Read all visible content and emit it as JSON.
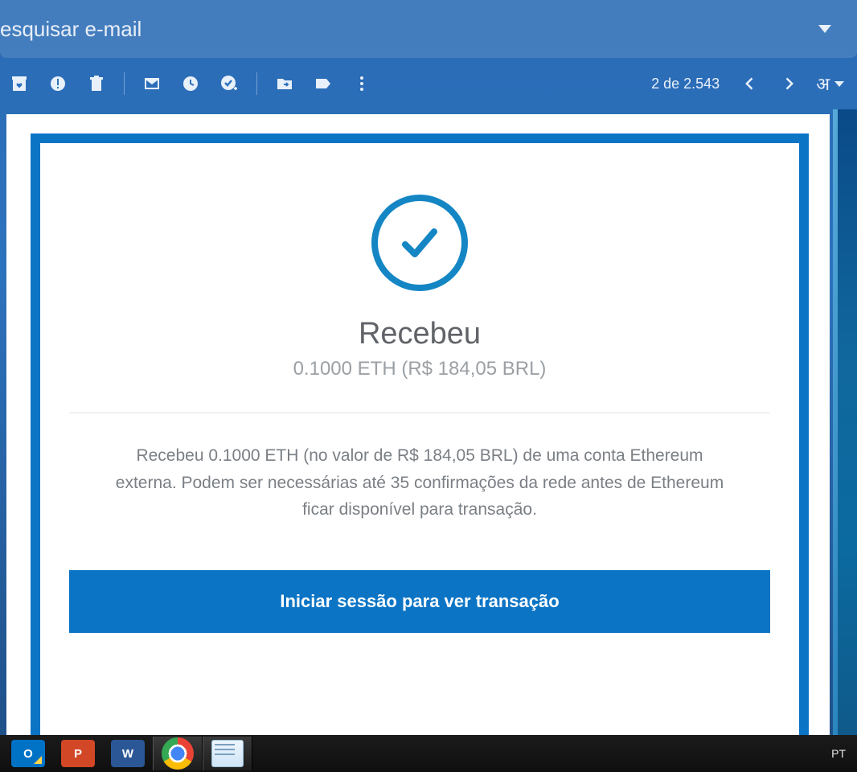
{
  "search": {
    "placeholder": "esquisar e-mail"
  },
  "toolbar": {
    "icons": {
      "archive": "archive",
      "spam": "report-spam",
      "delete": "delete",
      "unread": "mark-unread",
      "snooze": "snooze",
      "addtask": "add-task",
      "move": "move-to",
      "label": "label",
      "more": "more"
    },
    "pagination": "2 de 2.543",
    "lang_glyph": "अ"
  },
  "email": {
    "title": "Recebeu",
    "subtitle": "0.1000 ETH (R$ 184,05 BRL)",
    "body": "Recebeu 0.1000 ETH (no valor de R$ 184,05 BRL) de uma conta Ethereum externa. Podem ser necessárias até 35 confirmações da rede antes de Ethereum ficar disponível para transação.",
    "cta": "Iniciar sessão para ver transação"
  },
  "taskbar": {
    "outlook": "O",
    "powerpoint": "P",
    "word": "W",
    "lang": "PT"
  }
}
